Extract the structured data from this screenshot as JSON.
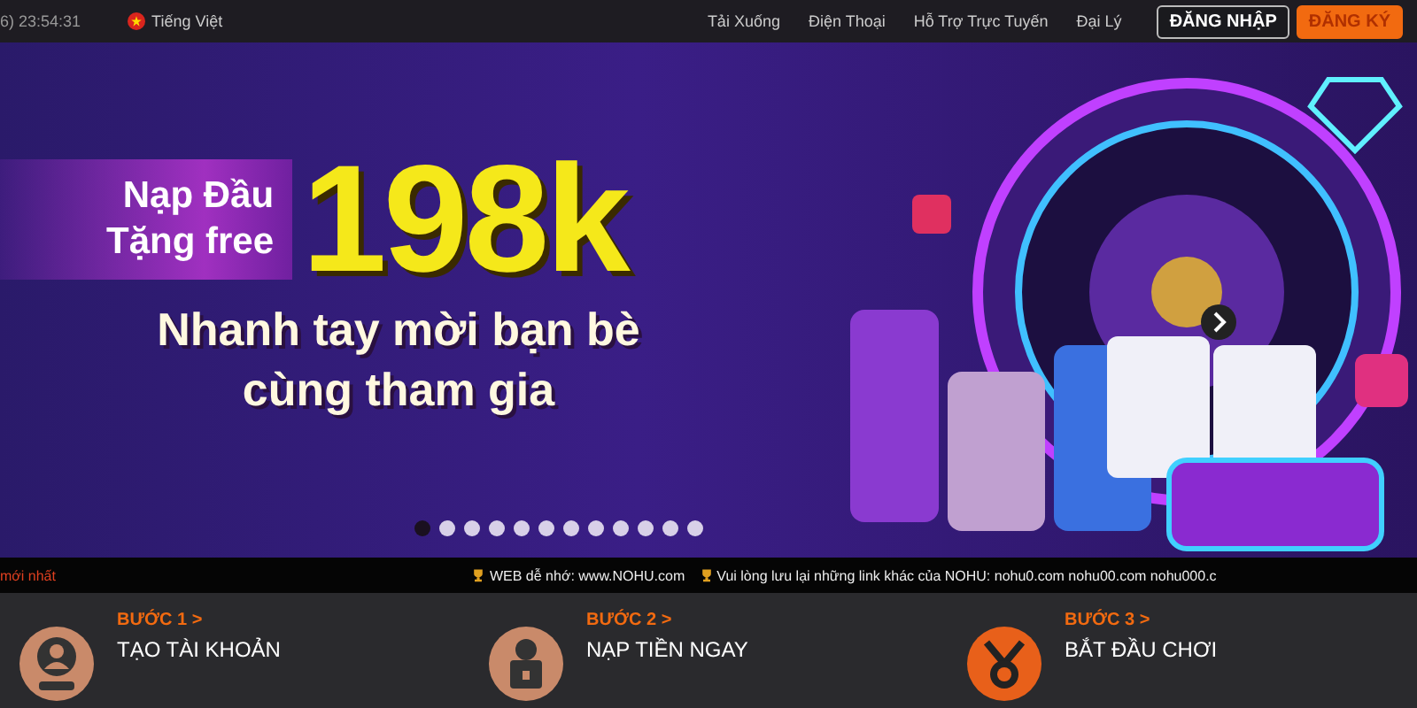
{
  "top_bar": {
    "clock": "6) 23:54:31",
    "language": "Tiếng Việt",
    "nav": [
      "Tải Xuống",
      "Điện Thoại",
      "Hỗ Trợ Trực Tuyến",
      "Đại Lý"
    ],
    "buttons": [
      {
        "label": "ĐĂNG NHẬP",
        "kind": "outline"
      },
      {
        "label": "ĐĂNG KÝ",
        "kind": "filled"
      }
    ]
  },
  "banner": {
    "ribbon_lines": [
      "Nạp Đầu",
      "Tặng free"
    ],
    "amount": "198k",
    "subtitle_lines": [
      "Nhanh tay mời bạn bè",
      "cùng tham gia"
    ],
    "dots": [
      {
        "selected": true
      },
      {
        "selected": false
      },
      {
        "selected": false
      },
      {
        "selected": false
      },
      {
        "selected": false
      },
      {
        "selected": false
      },
      {
        "selected": false
      },
      {
        "selected": false
      },
      {
        "selected": false
      },
      {
        "selected": false
      },
      {
        "selected": false
      },
      {
        "selected": false
      }
    ]
  },
  "ticker": {
    "label": "mới nhất",
    "items": [
      "WEB dễ nhớ: www.NOHU.com",
      "Vui lòng lưu lại những link khác của NOHU: nohu0.com nohu00.com nohu000.c"
    ]
  },
  "steps": [
    {
      "step": "BƯỚC 1 >",
      "title": "TẠO TÀI KHOẢN",
      "kind": "user"
    },
    {
      "step": "BƯỚC 2 >",
      "title": "NẠP TIỀN NGAY",
      "kind": "deposit"
    },
    {
      "step": "BƯỚC 3 >",
      "title": "BẮT ĐẦU CHƠI",
      "kind": "medal"
    }
  ]
}
